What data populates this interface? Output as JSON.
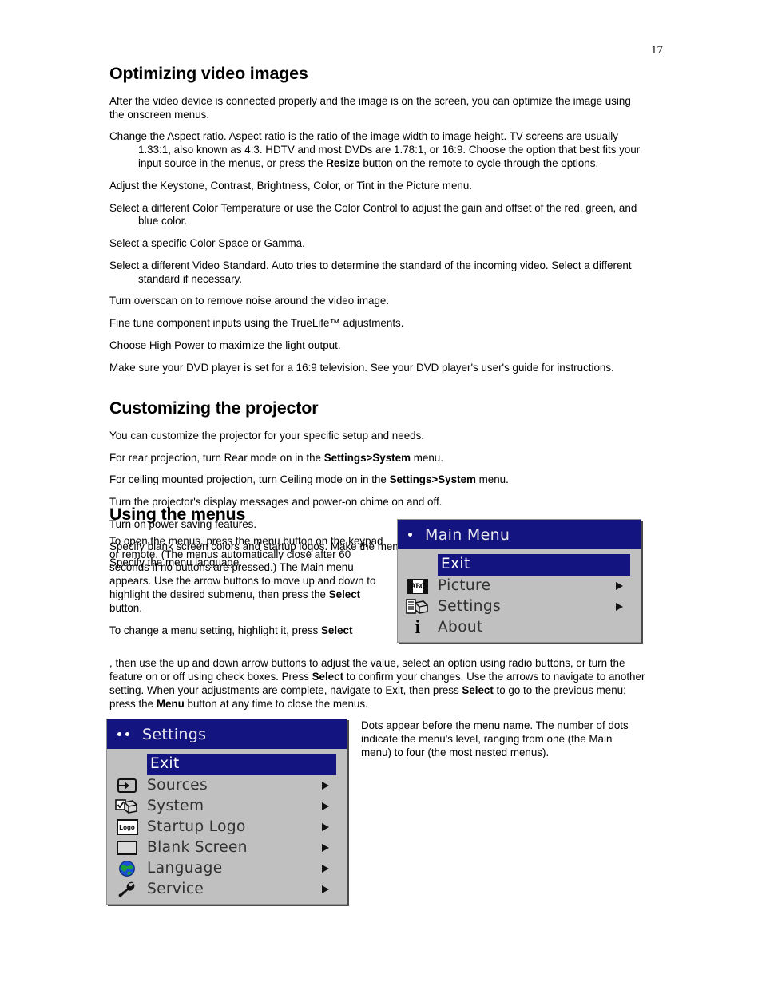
{
  "page": {
    "number": "17"
  },
  "sections": {
    "optimizing": {
      "title": "Optimizing video images",
      "intro": "After the video device is connected properly and the image is on the screen, you can optimize the image using the onscreen menus.",
      "items": [
        "Change the Aspect ratio. Aspect ratio is the ratio of the image width to image height. TV screens are usually 1.33:1, also known as 4:3. HDTV and most DVDs are 1.78:1, or 16:9. Choose the option that best fits your input source in the menus, or press the ",
        "Adjust the Keystone, Contrast, Brightness, Color, or Tint in the Picture menu.",
        "Select a different Color Temperature or use the Color Control to adjust the gain and offset of the red, green, and blue color.",
        "Select a specific Color Space or Gamma.",
        "Select a different Video Standard. Auto tries to determine the standard of the incoming video. Select a different standard if necessary.",
        "Turn overscan on to remove noise around the video image.",
        "Fine tune component inputs using the TrueLife™ adjustments.",
        "Choose High Power to maximize the light output.",
        "Make sure your DVD player is set for a 16:9 television. See your DVD player's user's guide for instructions."
      ],
      "item1_bold": "Resize",
      "item1_tail": " button on the remote to cycle through the options."
    },
    "customizing": {
      "title": "Customizing the projector",
      "intro": "You can customize the projector for your specific setup and needs.",
      "item_rear_a": "For rear projection, turn Rear mode on in the ",
      "item_rear_bold": "Settings>System",
      "item_rear_b": " menu.",
      "item_ceiling_a": "For ceiling mounted projection, turn Ceiling mode on in the ",
      "item_ceiling_bold": "Settings>System",
      "item_ceiling_b": " menu.",
      "items": [
        "Turn the projector's display messages and power-on chime on and off.",
        "Turn on power saving features.",
        "Specify blank screen colors and startup logos. Make the menus translucent.",
        "Specify the menu language."
      ]
    },
    "using_menus": {
      "title": "Using the menus",
      "para1_a": "To open the menus, press the menu button on the keypad or remote. (The menus automatically close after 60 seconds if no buttons are pressed.) The Main menu appears. Use the arrow buttons to move up and down to highlight the desired submenu, then press the ",
      "para1_bold": "Select",
      "para1_b": " button.",
      "para2_a": "To change a menu setting, highlight it, press ",
      "para2_bold1": "Select",
      "para2_b": ", then use the up and down arrow buttons to adjust the value, select an option using radio buttons, or turn the feature on or off using check boxes. Press ",
      "para2_bold2": "Select",
      "para2_c": " to confirm your changes. Use the arrows to navigate to another setting. When your adjustments are complete, navigate to Exit, then press ",
      "para2_bold3": "Select",
      "para2_d": " to go to the previous menu; press the ",
      "para2_bold4": "Menu",
      "para2_e": " button at any time to close the menus."
    },
    "dots_note": "Dots appear before the menu name. The number of dots indicate the menu's level, ranging from one (the Main menu) to four (the most nested menus)."
  },
  "osd": {
    "colors": {
      "title_bar": "#141480",
      "body": "#c0c0c0",
      "highlight": "#141480",
      "label": "#303030"
    },
    "main_menu": {
      "title": "Main Menu",
      "dot_count": 1,
      "rows": [
        {
          "label": "Exit",
          "icon": "",
          "selected": true,
          "arrow": false
        },
        {
          "label": "Picture",
          "icon": "abc-picture-icon",
          "selected": false,
          "arrow": true
        },
        {
          "label": "Settings",
          "icon": "projector-settings-icon",
          "selected": false,
          "arrow": true
        },
        {
          "label": "About",
          "icon": "info-icon",
          "selected": false,
          "arrow": false
        }
      ]
    },
    "settings_menu": {
      "title": "Settings",
      "dot_count": 2,
      "rows": [
        {
          "label": "Exit",
          "icon": "",
          "selected": true,
          "arrow": false
        },
        {
          "label": "Sources",
          "icon": "source-input-icon",
          "selected": false,
          "arrow": true
        },
        {
          "label": "System",
          "icon": "projector-check-icon",
          "selected": false,
          "arrow": true
        },
        {
          "label": "Startup Logo",
          "icon": "logo-box-icon",
          "selected": false,
          "arrow": true
        },
        {
          "label": "Blank Screen",
          "icon": "blank-screen-icon",
          "selected": false,
          "arrow": true
        },
        {
          "label": "Language",
          "icon": "globe-icon",
          "selected": false,
          "arrow": true
        },
        {
          "label": "Service",
          "icon": "wrench-icon",
          "selected": false,
          "arrow": true
        }
      ]
    },
    "logo_icon_text": "Logo",
    "abc_icon_text": "ABC",
    "info_icon_text": "i"
  }
}
